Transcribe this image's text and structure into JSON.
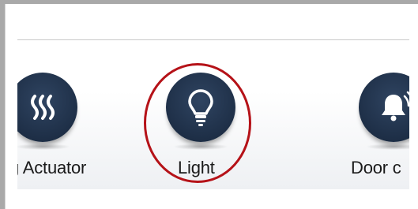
{
  "colors": {
    "accent_ring": "#b51218",
    "icon_disc": "#1e2f47",
    "icon_glyph": "#ffffff",
    "label_text": "#1a1a1a"
  },
  "carousel": {
    "items": [
      {
        "label": "ng Actuator",
        "icon": "heating-icon"
      },
      {
        "label": "Light",
        "icon": "light-bulb-icon",
        "highlighted": true
      },
      {
        "label": "Door c",
        "icon": "door-bell-icon"
      }
    ]
  }
}
